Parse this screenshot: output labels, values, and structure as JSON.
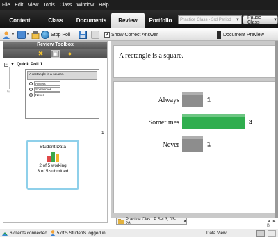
{
  "menu": [
    "File",
    "Edit",
    "View",
    "Tools",
    "Class",
    "Window",
    "Help"
  ],
  "tabs": [
    {
      "label": "Content",
      "active": false
    },
    {
      "label": "Class",
      "active": false
    },
    {
      "label": "Documents",
      "active": false
    },
    {
      "label": "Review",
      "active": true
    },
    {
      "label": "Portfolio",
      "active": false
    }
  ],
  "class_select": {
    "value": "Practice Class - 3rd Period"
  },
  "pause_button": {
    "label": "Pause Class"
  },
  "toolbar": {
    "stop_poll_label": "Stop Poll",
    "show_correct_answer_label": "Show Correct Answer",
    "show_correct_answer_checked": true,
    "document_preview_label": "Document Preview"
  },
  "review_toolbox": {
    "title": "Review Toolbox",
    "poll_title": "Quick Poll 1",
    "thumbnail": {
      "question": "A rectangle is a square.",
      "options": [
        "Always",
        "Sometimes",
        "Never"
      ]
    },
    "count": "1",
    "student_data": {
      "title": "Student Data",
      "working": "2 of 5 working",
      "submitted": "3 of 5 submitted"
    }
  },
  "question_text": "A rectangle is a square.",
  "chart_data": {
    "type": "bar",
    "orientation": "horizontal",
    "categories": [
      "Always",
      "Sometimes",
      "Never"
    ],
    "values": [
      1,
      3,
      1
    ],
    "correct": "Sometimes",
    "colors": {
      "correct": "#2fae4e",
      "other": "#8d8d8d"
    }
  },
  "doc_tab": {
    "label": "Practice Clas...P Set 3, 03-26",
    "close": "×"
  },
  "pager": "◄ ► B",
  "status": {
    "clients": "6 clients connected",
    "students": "5 of 5 Students logged in",
    "data_view": "Data View:"
  }
}
